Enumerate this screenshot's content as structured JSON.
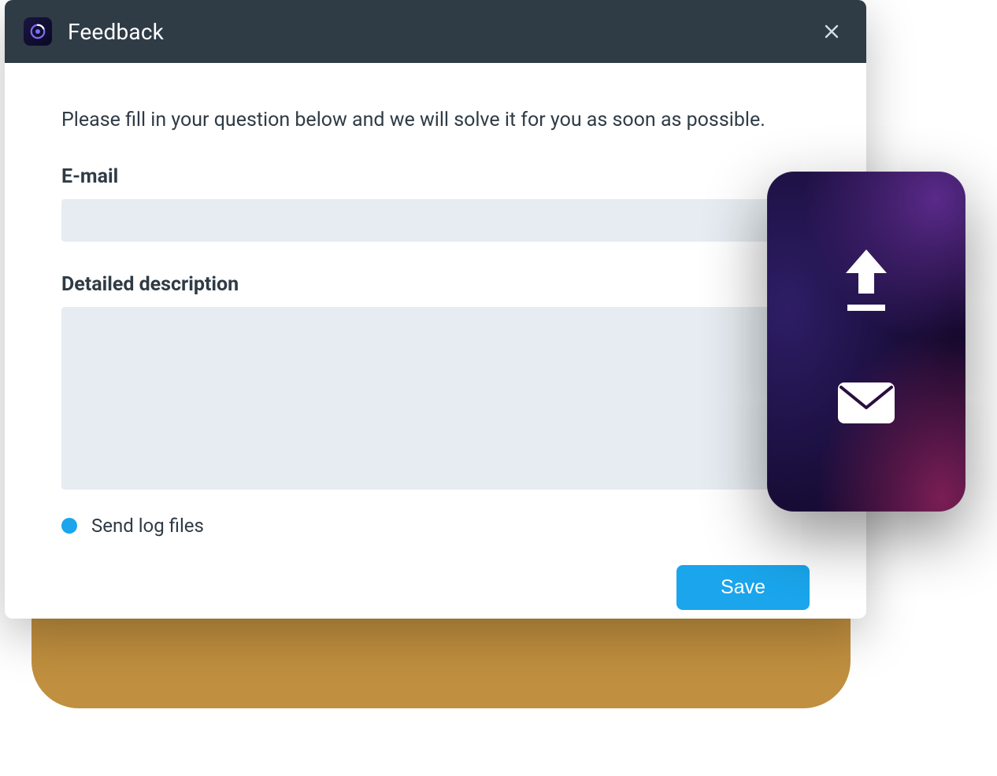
{
  "window": {
    "title": "Feedback"
  },
  "form": {
    "intro": "Please fill in your question below and we will solve it for you as soon as possible.",
    "email_label": "E-mail",
    "email_value": "",
    "description_label": "Detailed description",
    "description_value": "",
    "log_checkbox_label": "Send log files",
    "log_checkbox_checked": true,
    "save_label": "Save"
  },
  "colors": {
    "accent": "#1aa5ec",
    "titlebar": "#2f3b45",
    "input_bg": "#e6ecf1"
  },
  "side_panel": {
    "upload_icon": "upload-icon",
    "mail_icon": "mail-icon"
  }
}
